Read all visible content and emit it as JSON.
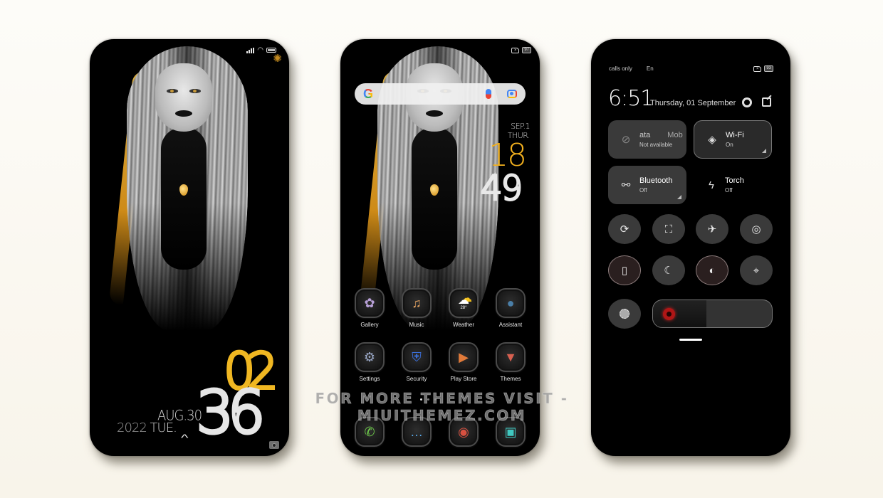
{
  "watermark": "FOR MORE THEMES VISIT - MIUITHEMEZ.COM",
  "lock_screen": {
    "clock_hour": "02",
    "clock_minute": "36",
    "date_line1": "AUG.30",
    "date_year": "2022",
    "date_weekday": "TUE.",
    "unlock_icon": "chevron-up-icon",
    "camera_icon": "camera-icon",
    "settings_icon": "gear-icon",
    "accent_color": "#f0b722"
  },
  "home_screen": {
    "status_battery": "97",
    "search_bar": {
      "logo": "G",
      "mic_icon": "mic-icon",
      "lens_icon": "lens-icon"
    },
    "clock_date": "SEP.1",
    "clock_weekday": "THUR.",
    "clock_hour": "18",
    "clock_minute": "49",
    "apps_row1": [
      {
        "label": "Gallery",
        "icon": "✿"
      },
      {
        "label": "Music",
        "icon": "♫"
      },
      {
        "label": "Weather",
        "icon": "☁",
        "temp": "28°"
      },
      {
        "label": "Assistant",
        "icon": "●"
      }
    ],
    "apps_row2": [
      {
        "label": "Settings",
        "icon": "⚙"
      },
      {
        "label": "Security",
        "icon": "⛨"
      },
      {
        "label": "Play Store",
        "icon": "▶"
      },
      {
        "label": "Themes",
        "icon": "▼"
      }
    ],
    "dock": [
      {
        "name": "phone",
        "icon": "✆"
      },
      {
        "name": "messages",
        "icon": "…"
      },
      {
        "name": "chrome",
        "icon": "◉"
      },
      {
        "name": "camera",
        "icon": "▣"
      }
    ],
    "page_count": 3,
    "current_page": 1
  },
  "control_center": {
    "carrier_text": "calls only",
    "carrier_text2": "En",
    "status_battery": "93",
    "time": "6:51",
    "date": "Thursday, 01 September",
    "tiles": {
      "data": {
        "title": "ata",
        "title2": "Mob",
        "subtitle": "Not available"
      },
      "wifi": {
        "title": "Wi-Fi",
        "subtitle": "On"
      },
      "bluetooth": {
        "title": "Bluetooth",
        "subtitle": "Off"
      },
      "torch": {
        "title": "Torch",
        "subtitle": "Off"
      }
    },
    "toggles_row1": [
      "auto-rotate-icon",
      "scan-icon",
      "airplane-mode-icon",
      "screenshot-icon"
    ],
    "toggles_row2": [
      "reading-mode-icon",
      "dark-mode-icon",
      "contrast-icon",
      "location-icon"
    ],
    "brightness_percent": 45
  }
}
